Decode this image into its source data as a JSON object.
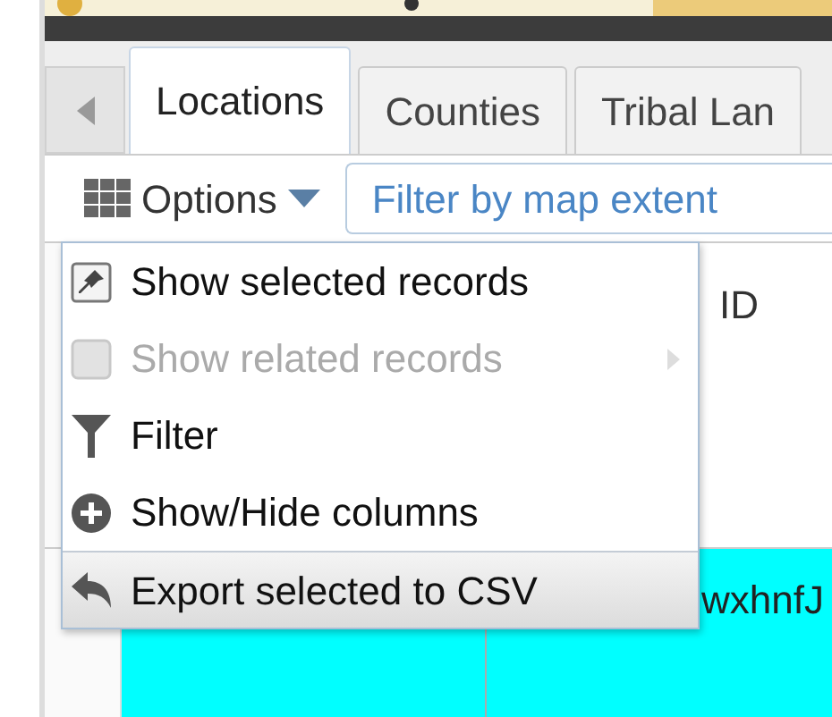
{
  "tabs": [
    {
      "label": "Locations",
      "selected": true
    },
    {
      "label": "Counties",
      "selected": false
    },
    {
      "label": "Tribal Lan",
      "selected": false
    }
  ],
  "toolbar": {
    "options_label": "Options",
    "filter_button": "Filter by map extent"
  },
  "table": {
    "header": {
      "column_3": "ID"
    },
    "rows": [
      {
        "column_3": "wxhnfJ",
        "selected": true
      }
    ]
  },
  "menu": {
    "items": [
      {
        "label": "Show selected records",
        "kind": "pin",
        "disabled": false,
        "submenu": false,
        "highlighted": false
      },
      {
        "label": "Show related records",
        "kind": "box",
        "disabled": true,
        "submenu": true,
        "highlighted": false
      },
      {
        "label": "Filter",
        "kind": "funnel",
        "disabled": false,
        "submenu": false,
        "highlighted": false
      },
      {
        "label": "Show/Hide columns",
        "kind": "plus",
        "disabled": false,
        "submenu": false,
        "highlighted": false
      },
      {
        "label": "Export selected to CSV",
        "kind": "reply",
        "disabled": false,
        "submenu": false,
        "highlighted": true
      }
    ]
  }
}
